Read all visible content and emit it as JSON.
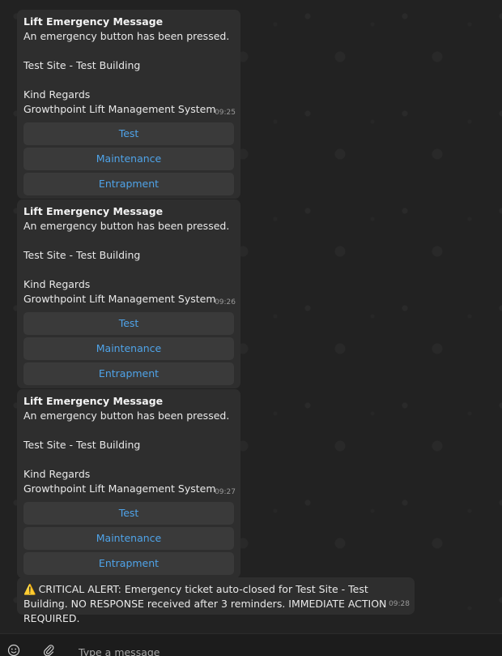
{
  "messages": [
    {
      "title": "Lift Emergency Message",
      "line1": "An emergency button has been pressed.",
      "site": "Test Site - Test Building",
      "regards": "Kind Regards",
      "signature": "Growthpoint Lift Management System",
      "time": "09:25",
      "buttons": [
        "Test",
        "Maintenance",
        "Entrapment"
      ]
    },
    {
      "title": "Lift Emergency Message",
      "line1": "An emergency button has been pressed.",
      "site": "Test Site - Test Building",
      "regards": "Kind Regards",
      "signature": "Growthpoint Lift Management System",
      "time": "09:26",
      "buttons": [
        "Test",
        "Maintenance",
        "Entrapment"
      ]
    },
    {
      "title": "Lift Emergency Message",
      "line1": "An emergency button has been pressed.",
      "site": "Test Site - Test Building",
      "regards": "Kind Regards",
      "signature": "Growthpoint Lift Management System",
      "time": "09:27",
      "buttons": [
        "Test",
        "Maintenance",
        "Entrapment"
      ]
    }
  ],
  "alert": {
    "icon": "warning-icon",
    "emoji": "⚠️",
    "text": "CRITICAL ALERT: Emergency ticket auto-closed for Test Site - Test Building. NO RESPONSE received after 3 reminders. IMMEDIATE ACTION REQUIRED.",
    "time": "09:28"
  },
  "composer": {
    "placeholder": "Type a message",
    "emoji_icon": "emoji-icon",
    "attach_icon": "paperclip-icon"
  },
  "colors": {
    "background": "#222222",
    "bubble": "#2e2e2e",
    "button": "#3a3a3a",
    "link": "#4fa3e8",
    "text": "#e9e9e9"
  }
}
